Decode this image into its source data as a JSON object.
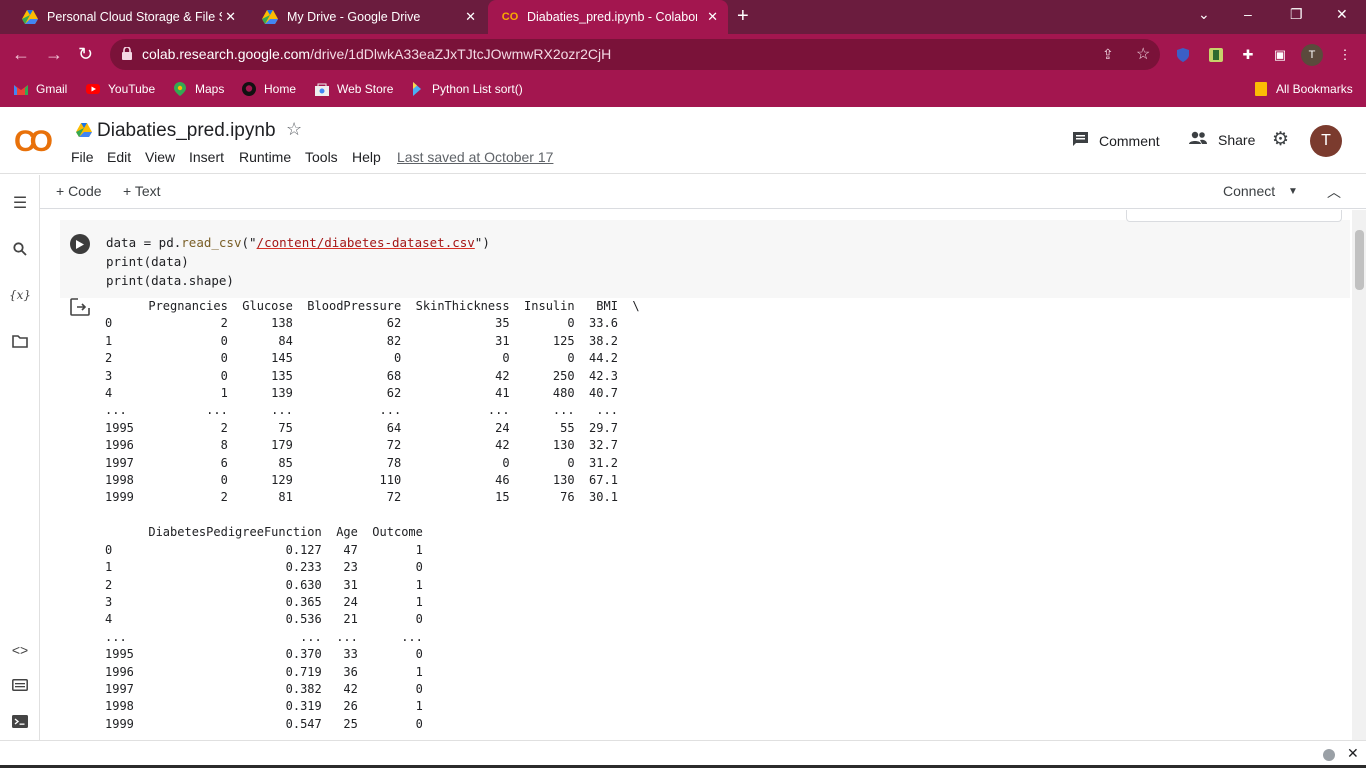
{
  "browser": {
    "tabs": [
      {
        "title": "Personal Cloud Storage & File Sh",
        "icon": "google-drive-icon",
        "active": false
      },
      {
        "title": "My Drive - Google Drive",
        "icon": "google-drive-icon",
        "active": false
      },
      {
        "title": "Diabaties_pred.ipynb - Colabora",
        "icon": "colab-icon",
        "active": true
      }
    ],
    "close_glyph": "✕",
    "new_tab_glyph": "+",
    "url_host": "colab.research.google.com",
    "url_path": "/drive/1dDlwkA33eaZJxTJtcJOwmwRX2ozr2CjH",
    "profile_initial": "T",
    "bookmarks": [
      {
        "label": "Gmail",
        "icon": "gmail-icon"
      },
      {
        "label": "YouTube",
        "icon": "youtube-icon"
      },
      {
        "label": "Maps",
        "icon": "maps-icon"
      },
      {
        "label": "Home",
        "icon": "github-icon"
      },
      {
        "label": "Web Store",
        "icon": "webstore-icon"
      },
      {
        "label": "Python List sort()",
        "icon": "python-icon"
      }
    ],
    "all_bookmarks": "All Bookmarks",
    "colors": {
      "tab_bg": "#6b1c3e",
      "active_tab": "#a3164f",
      "omnibox": "#7a1239"
    }
  },
  "colab": {
    "logo": "CO",
    "notebook_title": "Diabaties_pred.ipynb",
    "menu": [
      "File",
      "Edit",
      "View",
      "Insert",
      "Runtime",
      "Tools",
      "Help"
    ],
    "last_saved": "Last saved at October 17",
    "comment_label": "Comment",
    "share_label": "Share",
    "avatar_initial": "T",
    "toolbar": {
      "add_code": "+ Code",
      "add_text": "+ Text",
      "connect": "Connect"
    }
  },
  "cell": {
    "line1_a": "data = pd.",
    "line1_fn": "read_csv",
    "line1_b": "(\"",
    "line1_str": "/content/diabetes-dataset.csv",
    "line1_c": "\")",
    "line2": "print(data)",
    "line3": "print(data.shape)"
  },
  "output": {
    "text": "      Pregnancies  Glucose  BloodPressure  SkinThickness  Insulin   BMI  \\\n0               2      138             62             35        0  33.6   \n1               0       84             82             31      125  38.2   \n2               0      145              0              0        0  44.2   \n3               0      135             68             42      250  42.3   \n4               1      139             62             41      480  40.7   \n...           ...      ...            ...            ...      ...   ...   \n1995            2       75             64             24       55  29.7   \n1996            8      179             72             42      130  32.7   \n1997            6       85             78              0        0  31.2   \n1998            0      129            110             46      130  67.1   \n1999            2       81             72             15       76  30.1   \n\n      DiabetesPedigreeFunction  Age  Outcome  \n0                        0.127   47        1  \n1                        0.233   23        0  \n2                        0.630   31        1  \n3                        0.365   24        1  \n4                        0.536   21        0  \n...                        ...  ...      ...  \n1995                     0.370   33        0  \n1996                     0.719   36        1  \n1997                     0.382   42        0  \n1998                     0.319   26        1  \n1999                     0.547   25        0  "
  }
}
